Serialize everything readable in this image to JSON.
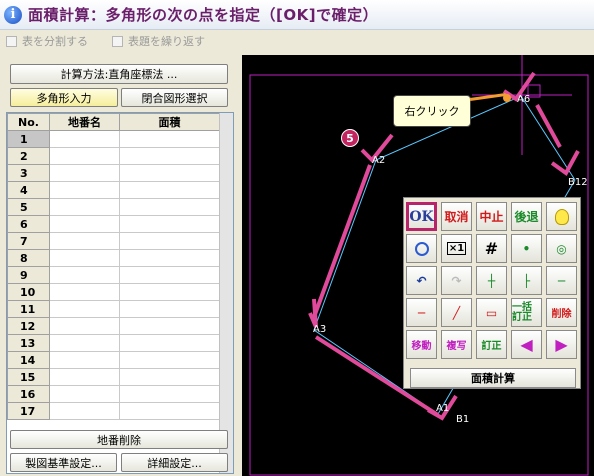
{
  "title": "面積計算：多角形の次の点を指定（[OK]で確定）",
  "options": {
    "split_table": "表を分割する",
    "repeat_title": "表題を繰り返す"
  },
  "left": {
    "method_button": "計算方法:直角座標法 ...",
    "polygon_input": "多角形入力",
    "closed_shape": "閉合図形選択",
    "table": {
      "headers": [
        "No.",
        "地番名",
        "面積"
      ],
      "rows": [
        "1",
        "2",
        "3",
        "4",
        "5",
        "6",
        "7",
        "8",
        "9",
        "10",
        "11",
        "12",
        "13",
        "14",
        "15",
        "16",
        "17"
      ]
    },
    "delete_button": "地番削除",
    "base_settings": "製図基準設定...",
    "detail_settings": "詳細設定..."
  },
  "canvas": {
    "tooltip": "右クリック",
    "step_badge": "5",
    "points": {
      "a6": "A6",
      "a2": "A2",
      "b12": "B12",
      "a3": "A3",
      "a1": "A1",
      "b1": "B1"
    }
  },
  "palette": {
    "ok": "OK",
    "cancel": "取消",
    "abort": "中止",
    "back": "後退",
    "bulk_correct": "一括訂正",
    "delete": "削除",
    "move": "移動",
    "copy": "複写",
    "correct": "訂正",
    "area_calc": "面積計算"
  }
}
